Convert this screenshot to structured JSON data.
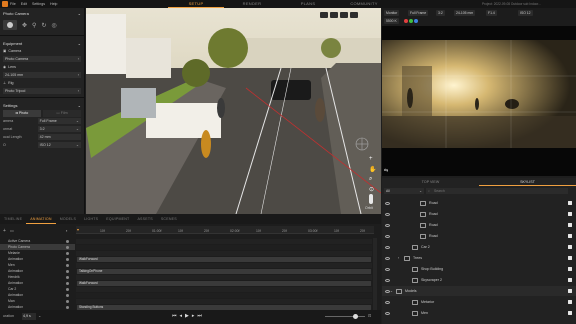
{
  "topbar": {
    "menu": [
      "File",
      "Edit",
      "Settings",
      "Help"
    ],
    "tabs": [
      "SETUP",
      "RENDER",
      "PLANS",
      "COMMUNITY"
    ],
    "active_tab": "SETUP",
    "project_title": "Project: 2022-09-08 Outdoor sub Indoor..."
  },
  "left_panel": {
    "header": "Photo Camera",
    "equipment_title": "Equipment",
    "camera_label": "Camera",
    "camera_value": "Photo Camera",
    "lens_label": "Lens",
    "lens_value": "24-105 mm",
    "rig_label": "Rig",
    "rig_value": "Photo Tripod",
    "settings_title": "Settings",
    "mode_photo": "Photo",
    "mode_film": "Film",
    "fields": [
      {
        "label": "amera",
        "value": "Full Frame"
      },
      {
        "label": "ormat",
        "value": "3:2"
      },
      {
        "label": "ocal Length",
        "value": "42 mm"
      },
      {
        "label": "O",
        "value": "ISO 12"
      }
    ]
  },
  "viewport": {
    "orbit_label": "Orbit"
  },
  "monitor": {
    "chips": [
      "Monitor",
      "Full Frame",
      "3:2",
      "24-105 mm",
      "F1.4",
      "ISO 12",
      "5500 K"
    ],
    "colors": {
      "accent": "#f0a040",
      "red": "#e04040",
      "green": "#40c040",
      "blue": "#4080e0"
    }
  },
  "outliner": {
    "tabs": [
      "TOP VIEW",
      "SKYLIST"
    ],
    "active_tab": "SKYLIST",
    "filter": "All",
    "search_placeholder": "Search",
    "items": [
      {
        "label": "Road",
        "indent": 3
      },
      {
        "label": "Road",
        "indent": 3
      },
      {
        "label": "Road",
        "indent": 3
      },
      {
        "label": "Road",
        "indent": 3
      },
      {
        "label": "Car 2",
        "indent": 2
      },
      {
        "label": "Trees",
        "indent": 1
      },
      {
        "label": "Shop Building",
        "indent": 2
      },
      {
        "label": "Skyscraper 2",
        "indent": 2
      },
      {
        "label": "Models",
        "indent": 0
      },
      {
        "label": "Metarior",
        "indent": 2
      },
      {
        "label": "Men",
        "indent": 2
      }
    ]
  },
  "timeline": {
    "tabs": [
      "TIMELINE",
      "ANIMATION",
      "MODELS",
      "LIGHTS",
      "EQUIPMENT",
      "ASSETS",
      "SCENES"
    ],
    "active_tab": "ANIMATION",
    "ruler": [
      "10f",
      "20f",
      "01:00f",
      "10f",
      "20f",
      "02:00f",
      "10f",
      "20f",
      "03:00f",
      "10f",
      "20f"
    ],
    "rows": [
      "Active Camera",
      "Photo Camera",
      "Melanie",
      "Animation",
      "Men",
      "Animation",
      "Hendrik",
      "Animation",
      "Car 2",
      "Animation",
      "Man",
      "Animation"
    ],
    "clips": [
      {
        "label": "WalkForward",
        "row": 3
      },
      {
        "label": "TalkingOnPhone",
        "row": 5
      },
      {
        "label": "WalkForward",
        "row": 7
      },
      {
        "label": "Standing Buttons",
        "row": 11
      }
    ],
    "duration_label": "uration",
    "duration_value": "4,9 s"
  }
}
